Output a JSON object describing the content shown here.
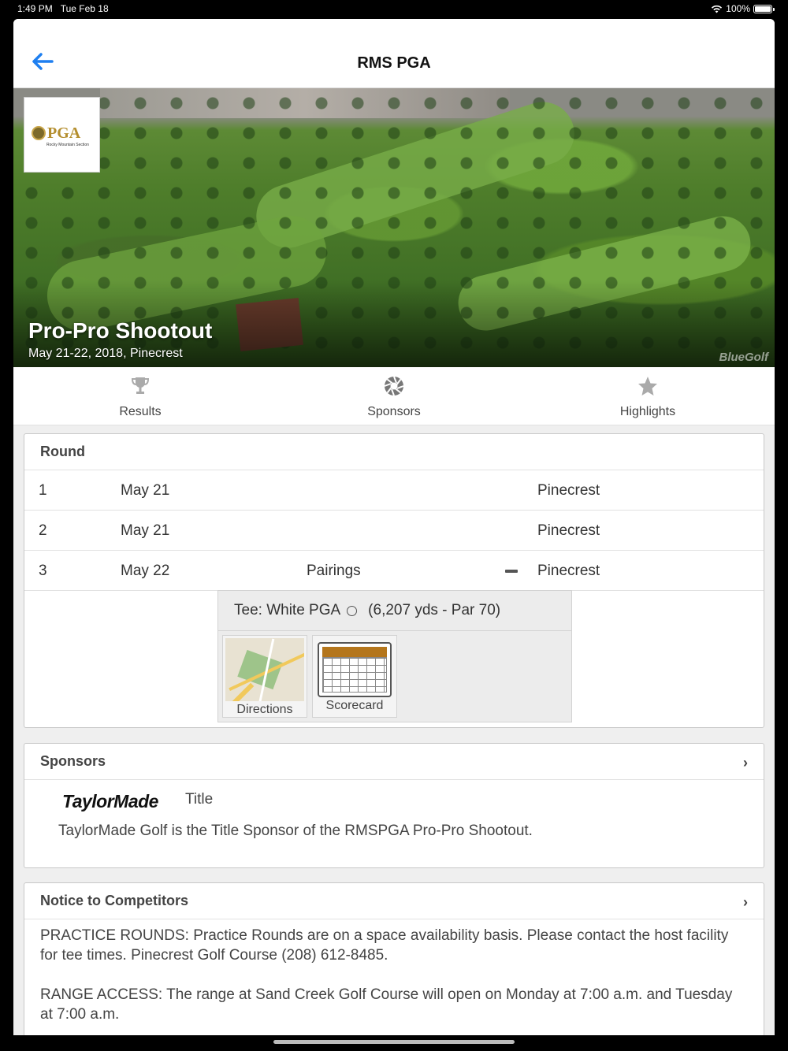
{
  "status": {
    "time": "1:49 PM",
    "date": "Tue Feb 18",
    "battery": "100%"
  },
  "nav": {
    "title": "RMS PGA"
  },
  "hero": {
    "title": "Pro-Pro Shootout",
    "subtitle": "May 21-22, 2018, Pinecrest",
    "logo_text": "PGA",
    "logo_sub": "Rocky Mountain Section",
    "watermark": "BlueGolf"
  },
  "tabs": [
    {
      "label": "Results",
      "icon": "trophy-icon"
    },
    {
      "label": "Sponsors",
      "icon": "aperture-icon"
    },
    {
      "label": "Highlights",
      "icon": "star-icon"
    }
  ],
  "rounds": {
    "header": "Round",
    "rows": [
      {
        "num": "1",
        "date": "May 21",
        "pairings": "",
        "course": "Pinecrest"
      },
      {
        "num": "2",
        "date": "May 21",
        "pairings": "",
        "course": "Pinecrest"
      },
      {
        "num": "3",
        "date": "May 22",
        "pairings": "Pairings",
        "course": "Pinecrest"
      }
    ],
    "tee": {
      "label": "Tee: White PGA",
      "details": "(6,207 yds - Par 70)"
    },
    "tiles": [
      {
        "label": "Directions"
      },
      {
        "label": "Scorecard"
      }
    ]
  },
  "sponsors": {
    "header": "Sponsors",
    "logo_text": "TaylorMade",
    "type": "Title",
    "description": "TaylorMade Golf is the Title Sponsor of the RMSPGA Pro-Pro Shootout."
  },
  "notice": {
    "header": "Notice to Competitors",
    "paragraphs": [
      "PRACTICE ROUNDS: Practice Rounds are on a space availability basis. Please contact the host facility for tee times. Pinecrest Golf Course (208) 612-8485.",
      "RANGE ACCESS: The range at Sand Creek Golf Course will open on Monday at 7:00 a.m. and Tuesday at 7:00 a.m."
    ]
  }
}
